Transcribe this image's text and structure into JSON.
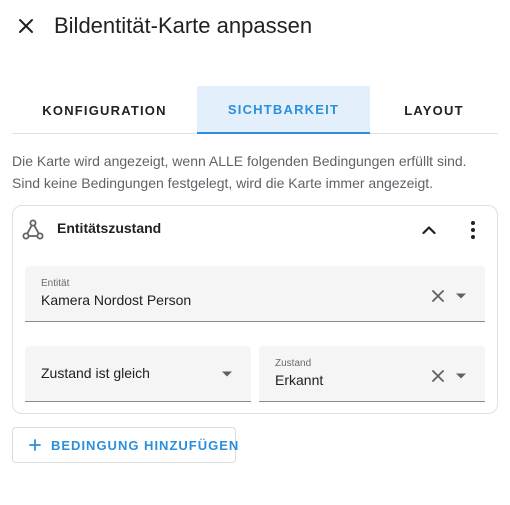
{
  "dialog": {
    "title": "Bildentität-Karte anpassen",
    "close_icon": "close-icon"
  },
  "tabs": [
    {
      "label": "KONFIGURATION",
      "active": false
    },
    {
      "label": "SICHTBARKEIT",
      "active": true
    },
    {
      "label": "LAYOUT",
      "active": false
    }
  ],
  "info": {
    "line1": "Die Karte wird angezeigt, wenn ALLE folgenden Bedingungen erfüllt sind.",
    "line2": "Sind keine Bedingungen festgelegt, wird die Karte immer angezeigt."
  },
  "condition": {
    "icon": "condition-icon",
    "title": "Entitätszustand",
    "collapse_icon": "chevron-up-icon",
    "menu_icon": "more-vertical-icon",
    "entity": {
      "label": "Entität",
      "value": "Kamera Nordost Person"
    },
    "mode": {
      "value": "Zustand ist gleich"
    },
    "state": {
      "label": "Zustand",
      "value": "Erkannt"
    }
  },
  "add_button": {
    "icon": "plus-icon",
    "label": "BEDINGUNG HINZUFÜGEN"
  },
  "colors": {
    "accent": "#2a8fdc",
    "active_tab_bg": "#e3f0fb",
    "field_bg": "#f5f5f5",
    "text": "#212121",
    "muted_text": "#5f6368"
  }
}
